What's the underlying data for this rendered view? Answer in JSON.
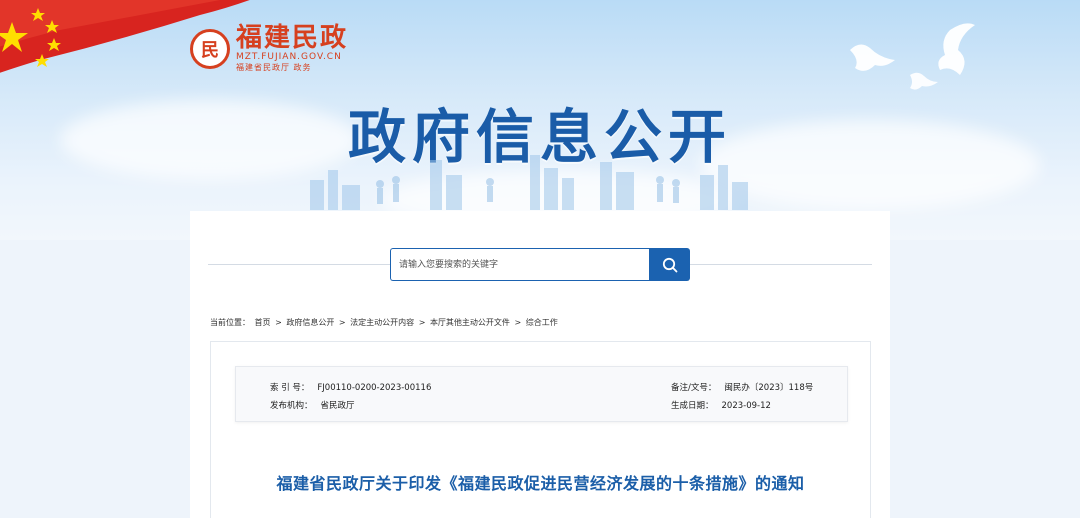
{
  "header": {
    "logo_emblem": "民",
    "logo_name": "福建民政",
    "logo_domain": "MZT.FUJIAN.GOV.CN",
    "logo_subtitle": "福建省民政厅 政务",
    "banner_title": "政府信息公开"
  },
  "search": {
    "placeholder": "请输入您要搜索的关键字",
    "button_icon": "search-icon"
  },
  "breadcrumb": {
    "prefix": "当前位置：",
    "items": [
      "首页",
      "政府信息公开",
      "法定主动公开内容",
      "本厅其他主动公开文件",
      "综合工作"
    ],
    "separator": ">"
  },
  "meta": {
    "index_label": "索  引  号：",
    "index_value": "FJ00110-0200-2023-00116",
    "publisher_label": "发布机构：",
    "publisher_value": "省民政厅",
    "docno_label": "备注/文号：",
    "docno_value": "闽民办〔2023〕118号",
    "date_label": "生成日期：",
    "date_value": "2023-09-12"
  },
  "document": {
    "title": "福建省民政厅关于印发《福建民政促进民营经济发展的十条措施》的通知"
  },
  "colors": {
    "primary_blue": "#1b62b0",
    "title_blue": "#1a5ca8",
    "logo_red": "#d6401f"
  }
}
